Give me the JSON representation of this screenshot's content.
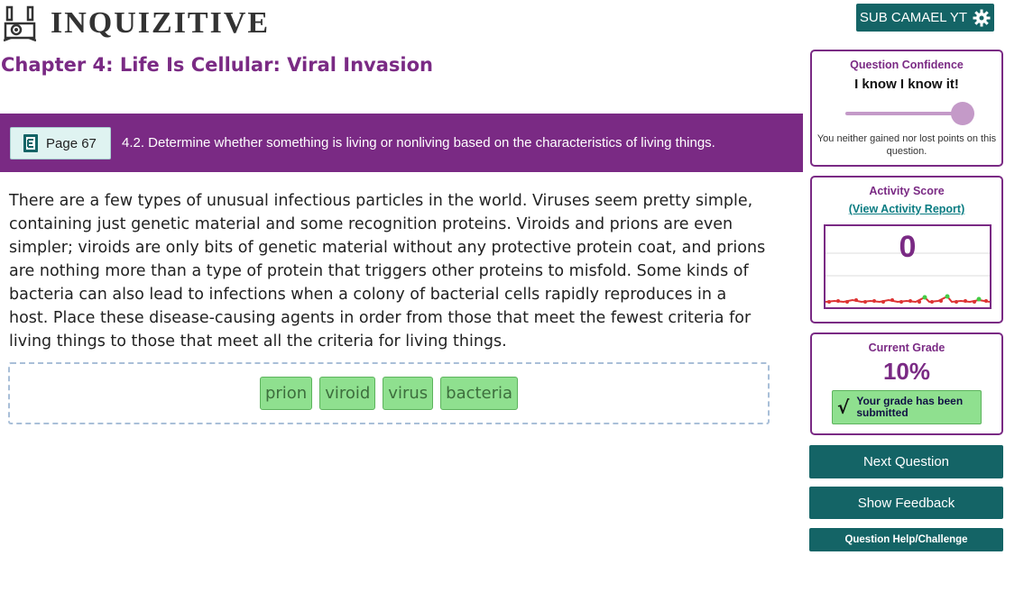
{
  "header": {
    "logo_text": "INQUIZITIVE",
    "user_button_label": "SUB CAMAEL YT"
  },
  "chapter": {
    "title": "Chapter 4: Life Is Cellular: Viral Invasion"
  },
  "objective_bar": {
    "page_label": "Page 67",
    "objective_text": "4.2. Determine whether something is living or nonliving based on the characteristics of living things."
  },
  "question": {
    "text": "There are a few types of unusual infectious particles in the world. Viruses seem pretty simple, containing just genetic material and some recognition proteins. Viroids and prions are even simpler; viroids are only bits of genetic material without any protective protein coat, and prions are nothing more than a type of protein that triggers other proteins to misfold. Some kinds of bacteria can also lead to infections when a colony of bacterial cells rapidly reproduces in a host. Place these disease-causing agents in order from those that meet the fewest criteria for living things to those that meet all the criteria for living things.",
    "answers": [
      "prion",
      "viroid",
      "virus",
      "bacteria"
    ]
  },
  "confidence": {
    "title": "Question Confidence",
    "value": "I know I know it!",
    "note": "You neither gained nor lost points on this question.",
    "level": 1.0
  },
  "activity": {
    "title": "Activity Score",
    "link": "(View Activity Report)",
    "score": "0"
  },
  "grade": {
    "title": "Current Grade",
    "value": "10%",
    "submitted_text": "Your grade has been submitted"
  },
  "buttons": {
    "next": "Next Question",
    "feedback": "Show Feedback",
    "help": "Question Help/Challenge"
  },
  "colors": {
    "brand_purple": "#7a2a84",
    "teal": "#146466",
    "chip_green": "#8fe08f"
  }
}
